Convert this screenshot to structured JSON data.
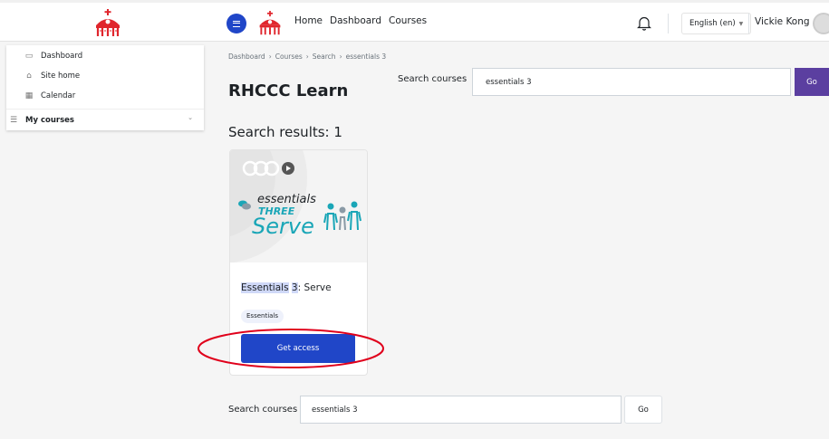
{
  "navbar": {
    "links": [
      "Home",
      "Dashboard",
      "Courses"
    ],
    "language": "English (en)",
    "user_name": "Vickie Kong"
  },
  "drawer": {
    "items": [
      {
        "label": "Dashboard",
        "icon": "table-icon"
      },
      {
        "label": "Site home",
        "icon": "home-icon"
      },
      {
        "label": "Calendar",
        "icon": "calendar-icon"
      }
    ],
    "my_courses_label": "My courses"
  },
  "breadcrumb": [
    "Dashboard",
    "Courses",
    "Search",
    "essentials 3"
  ],
  "site_title": "RHCCC Learn",
  "top_search": {
    "label": "Search courses",
    "value": "essentials 3",
    "go_label": "Go"
  },
  "results_heading": "Search results: 1",
  "course": {
    "title_highlight_1": "Essentials",
    "title_highlight_2": "3",
    "title_rest": ": Serve",
    "image_line_1": "essentials",
    "image_line_2": "THREE",
    "image_line_3": "Serve",
    "tag": "Essentials",
    "access_label": "Get access"
  },
  "bottom_search": {
    "label": "Search courses",
    "value": "essentials 3",
    "go_label": "Go"
  },
  "colors": {
    "primary": "#2046c8",
    "go_button": "#5b3fa0",
    "brand_red": "#e0262d",
    "annotation": "#e0001b",
    "image_teal": "#1aa6b7"
  }
}
